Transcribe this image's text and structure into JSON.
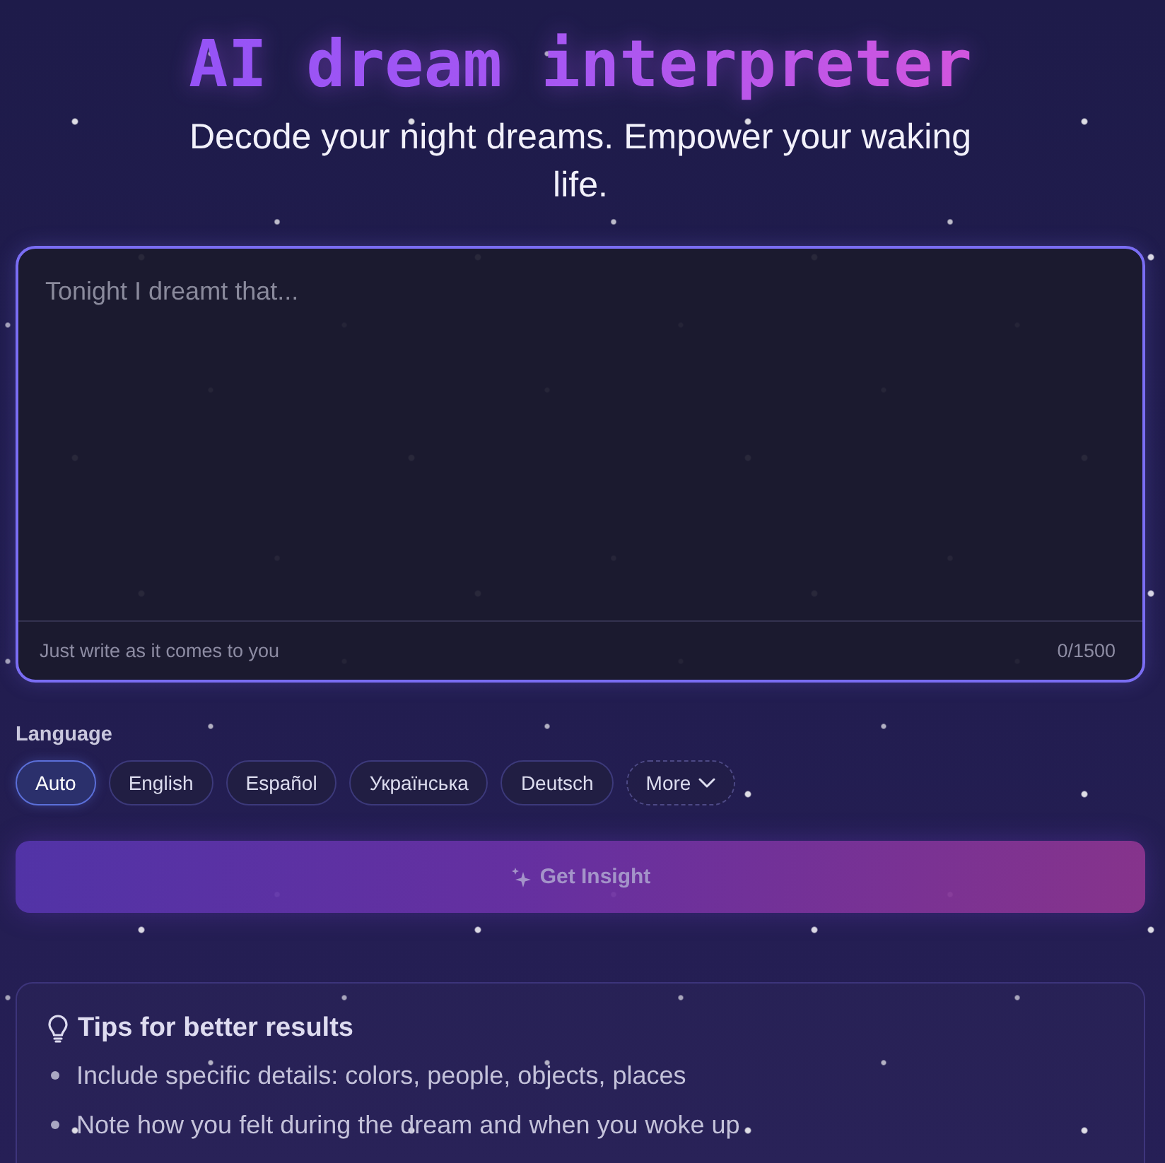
{
  "header": {
    "title": "AI dream interpreter",
    "subtitle": "Decode your night dreams. Empower your waking life."
  },
  "dream_entry": {
    "placeholder": "Tonight I dreamt that...",
    "hint": "Just write as it comes to you",
    "counter": "0/1500"
  },
  "language": {
    "label": "Language",
    "options": [
      {
        "label": "Auto",
        "selected": true
      },
      {
        "label": "English",
        "selected": false
      },
      {
        "label": "Español",
        "selected": false
      },
      {
        "label": "Українська",
        "selected": false
      },
      {
        "label": "Deutsch",
        "selected": false
      }
    ],
    "more_button": {
      "label": "More"
    }
  },
  "submit_button": {
    "label": "Get Insight",
    "disabled": true
  },
  "tips": {
    "title": "Tips for better results",
    "items": [
      "Include specific details: colors, people, objects, places",
      "Note how you felt during the dream and when you woke up"
    ]
  }
}
